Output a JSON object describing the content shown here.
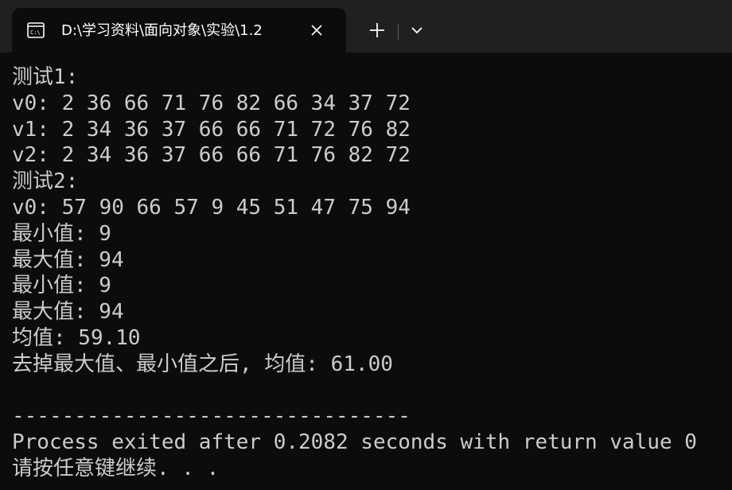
{
  "tab": {
    "title": "D:\\学习资料\\面向对象\\实验\\1.2",
    "icon": "console-icon",
    "close_icon": "close-icon",
    "new_tab_icon": "plus-icon",
    "dropdown_icon": "chevron-down-icon"
  },
  "colors": {
    "titlebar": "#202020",
    "console_bg": "#0c0c0c",
    "text": "#cccccc"
  },
  "console": {
    "lines": [
      "测试1:",
      "v0: 2 36 66 71 76 82 66 34 37 72",
      "v1: 2 34 36 37 66 66 71 72 76 82",
      "v2: 2 34 36 37 66 66 71 76 82 72",
      "测试2:",
      "v0: 57 90 66 57 9 45 51 47 75 94",
      "最小值: 9",
      "最大值: 94",
      "最小值: 9",
      "最大值: 94",
      "均值: 59.10",
      "去掉最大值、最小值之后, 均值: 61.00",
      "",
      "--------------------------------",
      "Process exited after 0.2082 seconds with return value 0",
      "请按任意键继续. . ."
    ]
  }
}
